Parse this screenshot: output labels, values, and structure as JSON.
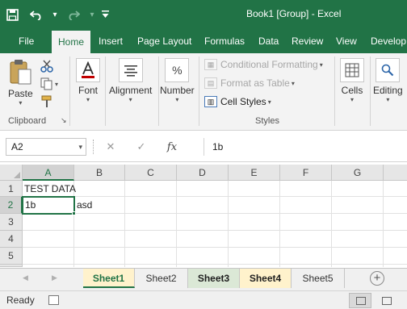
{
  "window": {
    "title": "Book1  [Group] - Excel"
  },
  "qat": {
    "save_icon": "save-icon",
    "undo_icon": "undo-icon",
    "redo_icon": "redo-icon",
    "customize_icon": "customize-qat-icon"
  },
  "tabs": [
    {
      "label": "File"
    },
    {
      "label": "Home"
    },
    {
      "label": "Insert"
    },
    {
      "label": "Page Layout"
    },
    {
      "label": "Formulas"
    },
    {
      "label": "Data"
    },
    {
      "label": "Review"
    },
    {
      "label": "View"
    },
    {
      "label": "Develop"
    }
  ],
  "ribbon": {
    "clipboard": {
      "paste": "Paste",
      "label": "Clipboard",
      "launcher": "↘"
    },
    "font": {
      "label": "Font"
    },
    "alignment": {
      "label": "Alignment"
    },
    "number": {
      "label": "Number",
      "glyph": "%"
    },
    "styles": {
      "conditional": "Conditional Formatting",
      "format_table": "Format as Table",
      "cell_styles": "Cell Styles",
      "label": "Styles"
    },
    "cells": {
      "label": "Cells"
    },
    "editing": {
      "label": "Editing"
    }
  },
  "formula_bar": {
    "name_box": "A2",
    "cancel": "✕",
    "enter": "✓",
    "fx": "fx",
    "content": "1b"
  },
  "grid": {
    "columns": [
      "A",
      "B",
      "C",
      "D",
      "E",
      "F",
      "G"
    ],
    "rows": [
      "1",
      "2",
      "3",
      "4",
      "5"
    ],
    "cells": {
      "A1": "TEST DATA",
      "A2": "1b",
      "B2": "asd"
    },
    "active_cell": "A2"
  },
  "sheets": [
    {
      "label": "Sheet1"
    },
    {
      "label": "Sheet2"
    },
    {
      "label": "Sheet3"
    },
    {
      "label": "Sheet4"
    },
    {
      "label": "Sheet5"
    }
  ],
  "add_sheet": "+",
  "status": {
    "text": "Ready"
  },
  "colors": {
    "accent": "#217346",
    "ribbon_bg": "#f3f3f3",
    "header_bg": "#e6e6e6"
  }
}
